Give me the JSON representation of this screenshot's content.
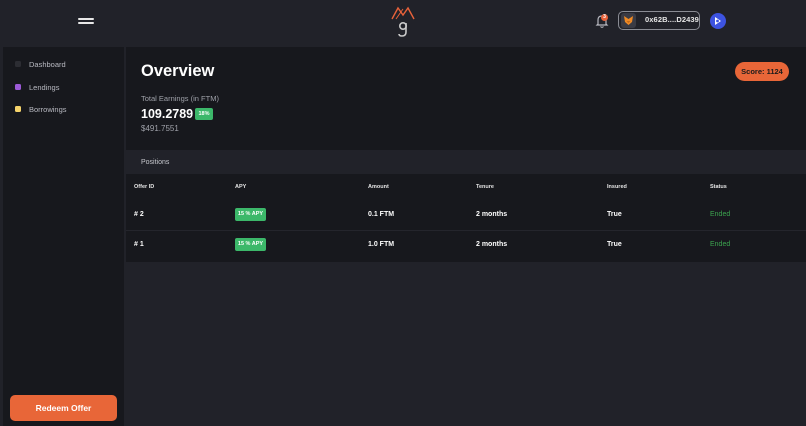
{
  "header": {
    "notifications_count": "3",
    "wallet_address": "0x62B....D2439"
  },
  "sidebar": {
    "items": [
      {
        "label": "Dashboard",
        "color": "#2c2d33"
      },
      {
        "label": "Lendings",
        "color": "#9b59d6"
      },
      {
        "label": "Borrowings",
        "color": "#f5d36b"
      }
    ],
    "redeem_label": "Redeem Offer"
  },
  "overview": {
    "title": "Overview",
    "score_label": "Score: 1124",
    "earnings_label": "Total Earnings (in FTM)",
    "earnings_value": "109.2789",
    "earnings_badge": "18%",
    "earnings_usd": "$491.7551"
  },
  "positions": {
    "label": "Positions",
    "columns": [
      "Offer ID",
      "APY",
      "Amount",
      "Tenure",
      "Insured",
      "Status"
    ],
    "rows": [
      {
        "offer_id": "# 2",
        "apy": "15 % APY",
        "amount": "0.1 FTM",
        "tenure": "2 months",
        "insured": "True",
        "status": "Ended"
      },
      {
        "offer_id": "# 1",
        "apy": "15 % APY",
        "amount": "1.0 FTM",
        "tenure": "2 months",
        "insured": "True",
        "status": "Ended"
      }
    ]
  },
  "colors": {
    "accent": "#e86638",
    "positive": "#3cb86a",
    "status_ended": "#3ca44f",
    "panel": "#17181d",
    "background": "#212229"
  }
}
